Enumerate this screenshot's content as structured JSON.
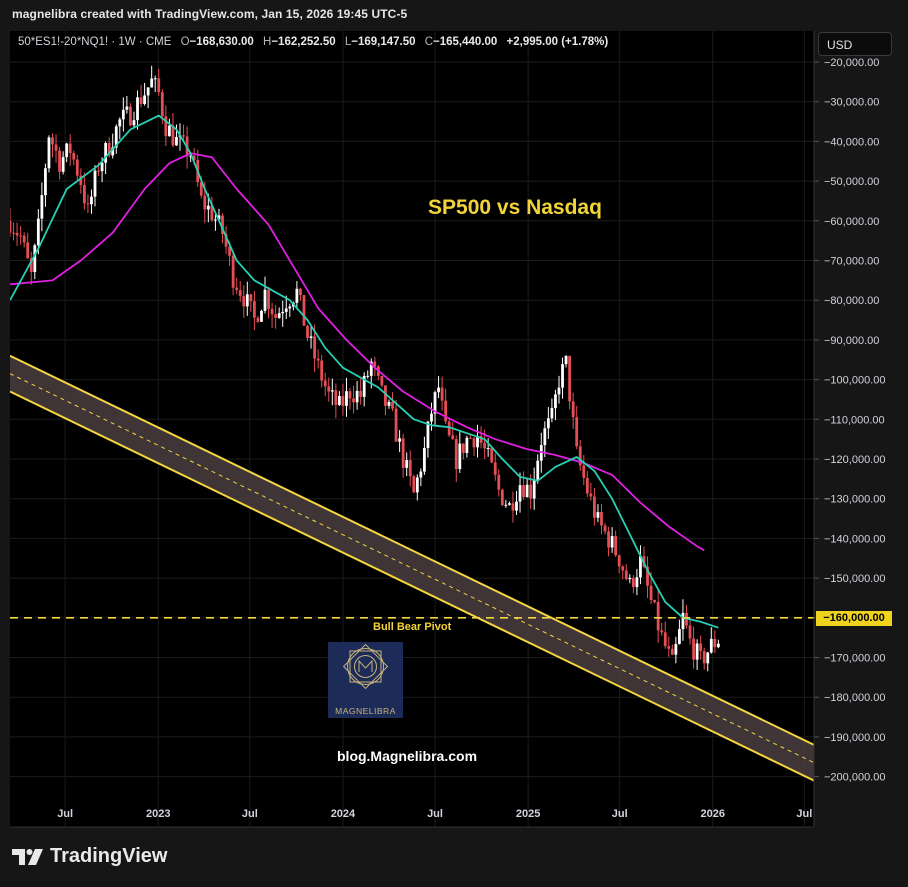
{
  "header": {
    "created_by": "magnelibra created with TradingView.com, Jan 15, 2026 19:45 UTC-5"
  },
  "legend": {
    "symbol": "50*ES1!-20*NQ1! · 1W · CME",
    "open_label": "O",
    "open": "−168,630.00",
    "high_label": "H",
    "high": "−162,252.50",
    "low_label": "L",
    "low": "−169,147.50",
    "close_label": "C",
    "close": "−165,440.00",
    "change": "+2,995.00 (+1.78%)"
  },
  "currency": "USD",
  "footer": {
    "brand": "TradingView"
  },
  "annotations": {
    "title": "SP500 vs Nasdaq",
    "pivot_label": "Bull Bear Pivot",
    "pivot_value": "−160,000.00",
    "blog": "blog.Magnelibra.com",
    "logo_text": "MAGNELIBRA"
  },
  "colors": {
    "up": "#ffffff",
    "down": "#e64e55",
    "ema_fast": "#26d0b4",
    "ema_slow": "#e020e0",
    "channel": "#f5d442",
    "channel_fill": "#4a3d3f",
    "pivot": "#f5d442"
  },
  "chart_data": {
    "type": "candlestick",
    "title": "SP500 vs Nasdaq",
    "yaxis": {
      "min": -205000,
      "max": -17500,
      "ticks": [
        -20000,
        -30000,
        -40000,
        -50000,
        -60000,
        -70000,
        -80000,
        -90000,
        -100000,
        -110000,
        -120000,
        -130000,
        -140000,
        -150000,
        -160000,
        -170000,
        -180000,
        -190000,
        -200000
      ],
      "tick_labels": [
        "−20,000.00",
        "−30,000.00",
        "−40,000.00",
        "−50,000.00",
        "−60,000.00",
        "−70,000.00",
        "−80,000.00",
        "−90,000.00",
        "−100,000.00",
        "−110,000.00",
        "−120,000.00",
        "−130,000.00",
        "−140,000.00",
        "−150,000.00",
        "−160,000.00",
        "−170,000.00",
        "−180,000.00",
        "−190,000.00",
        "−200,000.00"
      ]
    },
    "xaxis": {
      "start": "2022-03-14",
      "end": "2026-07-20",
      "ticks": [
        {
          "date": "2022-07-01",
          "label": "Jul"
        },
        {
          "date": "2023-01-01",
          "label": "2023"
        },
        {
          "date": "2023-07-01",
          "label": "Jul"
        },
        {
          "date": "2024-01-01",
          "label": "2024"
        },
        {
          "date": "2024-07-01",
          "label": "Jul"
        },
        {
          "date": "2025-01-01",
          "label": "2025"
        },
        {
          "date": "2025-07-01",
          "label": "Jul"
        },
        {
          "date": "2026-01-01",
          "label": "2026"
        },
        {
          "date": "2026-07-01",
          "label": "Jul"
        }
      ]
    },
    "close_path": [
      [
        "2022-03-14",
        -60000
      ],
      [
        "2022-04-04",
        -64000
      ],
      [
        "2022-04-25",
        -74000
      ],
      [
        "2022-05-09",
        -62000
      ],
      [
        "2022-05-30",
        -38000
      ],
      [
        "2022-06-20",
        -45000
      ],
      [
        "2022-07-11",
        -42000
      ],
      [
        "2022-08-01",
        -50000
      ],
      [
        "2022-08-15",
        -58000
      ],
      [
        "2022-09-05",
        -46000
      ],
      [
        "2022-09-26",
        -41000
      ],
      [
        "2022-10-17",
        -35000
      ],
      [
        "2022-11-07",
        -33000
      ],
      [
        "2022-11-28",
        -29000
      ],
      [
        "2022-12-19",
        -25000
      ],
      [
        "2023-01-02",
        -28000
      ],
      [
        "2023-01-16",
        -36000
      ],
      [
        "2023-02-06",
        -40000
      ],
      [
        "2023-03-06",
        -43000
      ],
      [
        "2023-03-27",
        -55000
      ],
      [
        "2023-04-17",
        -58000
      ],
      [
        "2023-05-08",
        -63000
      ],
      [
        "2023-05-29",
        -74000
      ],
      [
        "2023-06-19",
        -79000
      ],
      [
        "2023-07-10",
        -85000
      ],
      [
        "2023-07-31",
        -78000
      ],
      [
        "2023-08-21",
        -84000
      ],
      [
        "2023-09-11",
        -80000
      ],
      [
        "2023-10-02",
        -78000
      ],
      [
        "2023-10-23",
        -89000
      ],
      [
        "2023-11-13",
        -97000
      ],
      [
        "2023-12-04",
        -104000
      ],
      [
        "2023-12-25",
        -107000
      ],
      [
        "2024-01-15",
        -103000
      ],
      [
        "2024-02-05",
        -104000
      ],
      [
        "2024-02-26",
        -96000
      ],
      [
        "2024-03-18",
        -104000
      ],
      [
        "2024-04-08",
        -110000
      ],
      [
        "2024-04-29",
        -120000
      ],
      [
        "2024-05-20",
        -129000
      ],
      [
        "2024-06-10",
        -118000
      ],
      [
        "2024-06-24",
        -108000
      ],
      [
        "2024-07-08",
        -102000
      ],
      [
        "2024-07-22",
        -113000
      ],
      [
        "2024-08-12",
        -120000
      ],
      [
        "2024-09-02",
        -115000
      ],
      [
        "2024-09-23",
        -114000
      ],
      [
        "2024-10-14",
        -120000
      ],
      [
        "2024-11-04",
        -128000
      ],
      [
        "2024-11-25",
        -132000
      ],
      [
        "2024-12-16",
        -126000
      ],
      [
        "2025-01-06",
        -128000
      ],
      [
        "2025-01-27",
        -115000
      ],
      [
        "2025-02-17",
        -110000
      ],
      [
        "2025-03-03",
        -100000
      ],
      [
        "2025-03-17",
        -96000
      ],
      [
        "2025-04-07",
        -119000
      ],
      [
        "2025-04-28",
        -128000
      ],
      [
        "2025-05-19",
        -136000
      ],
      [
        "2025-06-09",
        -140000
      ],
      [
        "2025-06-30",
        -145000
      ],
      [
        "2025-07-21",
        -152000
      ],
      [
        "2025-08-11",
        -146000
      ],
      [
        "2025-09-01",
        -156000
      ],
      [
        "2025-09-22",
        -165000
      ],
      [
        "2025-10-13",
        -172000
      ],
      [
        "2025-11-03",
        -160000
      ],
      [
        "2025-11-17",
        -166000
      ],
      [
        "2025-12-08",
        -171000
      ],
      [
        "2025-12-29",
        -167000
      ],
      [
        "2026-01-12",
        -165440
      ]
    ],
    "ema_fast": [
      [
        "2022-03-14",
        -80000
      ],
      [
        "2022-05-09",
        -67000
      ],
      [
        "2022-07-04",
        -52000
      ],
      [
        "2022-09-05",
        -46000
      ],
      [
        "2022-11-07",
        -37000
      ],
      [
        "2023-01-02",
        -33500
      ],
      [
        "2023-02-06",
        -37000
      ],
      [
        "2023-03-06",
        -43000
      ],
      [
        "2023-04-03",
        -52000
      ],
      [
        "2023-05-01",
        -60000
      ],
      [
        "2023-06-05",
        -70000
      ],
      [
        "2023-07-10",
        -75000
      ],
      [
        "2023-08-14",
        -77500
      ],
      [
        "2023-09-18",
        -80000
      ],
      [
        "2023-10-23",
        -85000
      ],
      [
        "2023-11-27",
        -92000
      ],
      [
        "2024-01-01",
        -97000
      ],
      [
        "2024-02-05",
        -99500
      ],
      [
        "2024-03-11",
        -102000
      ],
      [
        "2024-04-15",
        -106000
      ],
      [
        "2024-05-20",
        -110000
      ],
      [
        "2024-06-24",
        -111500
      ],
      [
        "2024-07-29",
        -112000
      ],
      [
        "2024-09-02",
        -113500
      ],
      [
        "2024-10-07",
        -115000
      ],
      [
        "2024-11-11",
        -120000
      ],
      [
        "2024-12-16",
        -124500
      ],
      [
        "2025-01-20",
        -125500
      ],
      [
        "2025-02-24",
        -122000
      ],
      [
        "2025-04-07",
        -119500
      ],
      [
        "2025-05-12",
        -123000
      ],
      [
        "2025-06-16",
        -130000
      ],
      [
        "2025-07-21",
        -139000
      ],
      [
        "2025-08-25",
        -148000
      ],
      [
        "2025-09-29",
        -156000
      ],
      [
        "2025-11-03",
        -160000
      ],
      [
        "2025-12-08",
        -161000
      ],
      [
        "2026-01-12",
        -162500
      ]
    ],
    "ema_slow": [
      [
        "2022-03-14",
        -76000
      ],
      [
        "2022-06-06",
        -75000
      ],
      [
        "2022-08-01",
        -70000
      ],
      [
        "2022-10-03",
        -63000
      ],
      [
        "2022-12-05",
        -52000
      ],
      [
        "2023-01-23",
        -45500
      ],
      [
        "2023-03-06",
        -43000
      ],
      [
        "2023-04-17",
        -44000
      ],
      [
        "2023-06-05",
        -52000
      ],
      [
        "2023-08-07",
        -61000
      ],
      [
        "2023-10-02",
        -73000
      ],
      [
        "2023-11-13",
        -82000
      ],
      [
        "2024-01-08",
        -90000
      ],
      [
        "2024-03-04",
        -97000
      ],
      [
        "2024-04-29",
        -103000
      ],
      [
        "2024-07-01",
        -108000
      ],
      [
        "2024-09-02",
        -112000
      ],
      [
        "2024-10-28",
        -115000
      ],
      [
        "2024-12-30",
        -117500
      ],
      [
        "2025-02-24",
        -119000
      ],
      [
        "2025-04-21",
        -121000
      ],
      [
        "2025-06-16",
        -124000
      ],
      [
        "2025-08-11",
        -131000
      ],
      [
        "2025-10-06",
        -137000
      ],
      [
        "2025-12-01",
        -142000
      ],
      [
        "2025-12-15",
        -143000
      ]
    ],
    "channel": {
      "upper": [
        [
          "2022-03-14",
          -94000
        ],
        [
          "2026-07-20",
          -192000
        ]
      ],
      "mid": [
        [
          "2022-03-14",
          -98500
        ],
        [
          "2026-07-20",
          -196500
        ]
      ],
      "lower": [
        [
          "2022-03-14",
          -103000
        ],
        [
          "2026-07-20",
          -201000
        ]
      ]
    },
    "pivot_level": -160000
  }
}
